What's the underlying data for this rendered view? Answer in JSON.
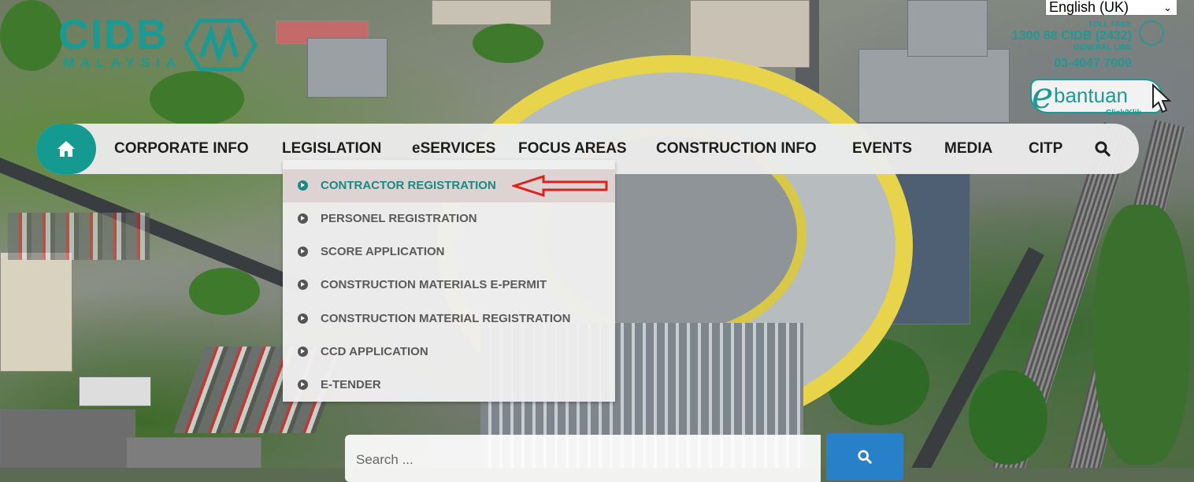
{
  "language": {
    "selected": "English (UK)"
  },
  "logo": {
    "main": "CIDB",
    "sub": "MALAYSIA"
  },
  "contact": {
    "label": "TOLL FREE",
    "phone1": "1300 88 CIDB (2432)",
    "label2": "GENERAL LINE",
    "phone2": "03-4047 7000"
  },
  "ebantuan": {
    "text": "bantuan",
    "prefix": "e",
    "click": "Click/Klik"
  },
  "nav": {
    "home_icon": "home-icon",
    "items": [
      "CORPORATE INFO",
      "LEGISLATION",
      "eSERVICES",
      "FOCUS AREAS",
      "CONSTRUCTION INFO",
      "EVENTS",
      "MEDIA",
      "CITP"
    ],
    "search_icon": "search-icon"
  },
  "dropdown": {
    "items": [
      "CONTRACTOR REGISTRATION",
      "PERSONEL REGISTRATION",
      "SCORE APPLICATION",
      "CONSTRUCTION MATERIALS E-PERMIT",
      "CONSTRUCTION MATERIAL REGISTRATION",
      "CCD APPLICATION",
      "E-TENDER"
    ],
    "active_index": 0
  },
  "search": {
    "placeholder": "Search ..."
  },
  "colors": {
    "brand": "#159a92",
    "search_button": "#2780c8",
    "highlight_arrow": "#e0201c"
  }
}
